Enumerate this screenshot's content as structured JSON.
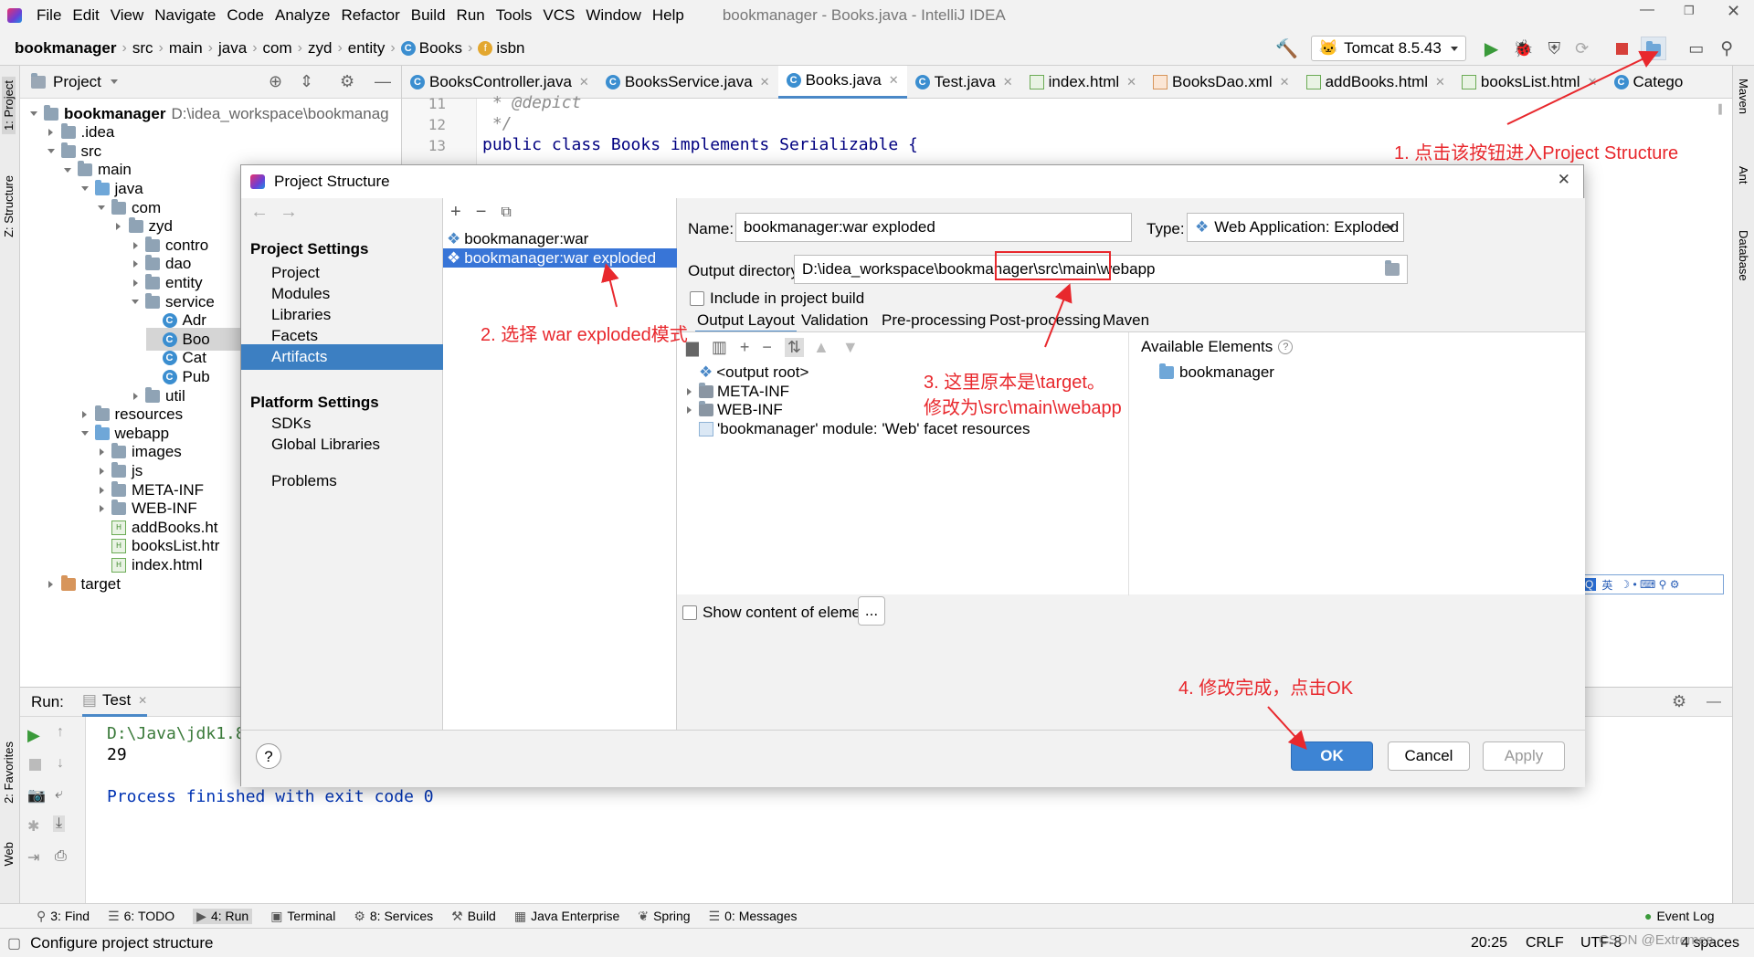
{
  "window": {
    "title": "bookmanager - Books.java - IntelliJ IDEA"
  },
  "menu": [
    "File",
    "Edit",
    "View",
    "Navigate",
    "Code",
    "Analyze",
    "Refactor",
    "Build",
    "Run",
    "Tools",
    "VCS",
    "Window",
    "Help"
  ],
  "breadcrumb": [
    "bookmanager",
    "src",
    "main",
    "java",
    "com",
    "zyd",
    "entity",
    "Books",
    "isbn"
  ],
  "run_config": "Tomcat 8.5.43",
  "project_panel": {
    "title": "Project",
    "tree": [
      {
        "label": "bookmanager",
        "extra": "D:\\idea_workspace\\bookmanag"
      },
      {
        "label": ".idea"
      },
      {
        "label": "src"
      },
      {
        "label": "main"
      },
      {
        "label": "java"
      },
      {
        "label": "com"
      },
      {
        "label": "zyd"
      },
      {
        "label": "contro"
      },
      {
        "label": "dao"
      },
      {
        "label": "entity"
      },
      {
        "label": "service"
      },
      {
        "label": "Adr"
      },
      {
        "label": "Boo"
      },
      {
        "label": "Cat"
      },
      {
        "label": "Pub"
      },
      {
        "label": "util"
      },
      {
        "label": "resources"
      },
      {
        "label": "webapp"
      },
      {
        "label": "images"
      },
      {
        "label": "js"
      },
      {
        "label": "META-INF"
      },
      {
        "label": "WEB-INF"
      },
      {
        "label": "addBooks.ht"
      },
      {
        "label": "booksList.htr"
      },
      {
        "label": "index.html"
      },
      {
        "label": "target"
      }
    ]
  },
  "editor": {
    "tabs": [
      "BooksController.java",
      "BooksService.java",
      "Books.java",
      "Test.java",
      "index.html",
      "BooksDao.xml",
      "addBooks.html",
      "booksList.html",
      "Catego"
    ],
    "active_tab": "Books.java",
    "lines": [
      {
        "num": "11",
        "text": " * @depict"
      },
      {
        "num": "12",
        "text": " */"
      },
      {
        "num": "13",
        "text": "public class Books implements Serializable {"
      }
    ]
  },
  "run_panel": {
    "label": "Run:",
    "tab": "Test",
    "output": [
      "D:\\Java\\jdk1.8",
      "29",
      "",
      "Process finished with exit code 0"
    ]
  },
  "left_stripe": [
    "1: Project",
    "Z: Structure",
    "2: Favorites",
    "Web"
  ],
  "right_stripe": [
    "Maven",
    "Ant",
    "Database"
  ],
  "tool_windows": [
    {
      "icon": "search-icon",
      "label": "3: Find"
    },
    {
      "icon": "todo-icon",
      "label": "6: TODO"
    },
    {
      "icon": "run-icon",
      "label": "4: Run"
    },
    {
      "icon": "terminal-icon",
      "label": "Terminal"
    },
    {
      "icon": "services-icon",
      "label": "8: Services"
    },
    {
      "icon": "build-icon",
      "label": "Build"
    },
    {
      "icon": "enterprise-icon",
      "label": "Java Enterprise"
    },
    {
      "icon": "spring-icon",
      "label": "Spring"
    },
    {
      "icon": "messages-icon",
      "label": "0: Messages"
    }
  ],
  "event_log": "Event Log",
  "status": {
    "message": "Configure project structure",
    "position": "20:25",
    "line_sep": "CRLF",
    "encoding": "UTF-8",
    "indent": "4 spaces",
    "watermark": "CSDN @Extremes",
    "ime": "英"
  },
  "dialog": {
    "title": "Project Structure",
    "project_settings_header": "Project Settings",
    "project_settings": [
      "Project",
      "Modules",
      "Libraries",
      "Facets",
      "Artifacts"
    ],
    "selected_setting": "Artifacts",
    "platform_settings_header": "Platform Settings",
    "platform_settings": [
      "SDKs",
      "Global Libraries"
    ],
    "problems": "Problems",
    "artifacts": [
      "bookmanager:war",
      "bookmanager:war exploded"
    ],
    "selected_artifact": "bookmanager:war exploded",
    "name_label": "Name:",
    "name_value": "bookmanager:war exploded",
    "type_label": "Type:",
    "type_value": "Web Application: Exploded",
    "output_label": "Output directory:",
    "output_value": "D:\\idea_workspace\\bookmanager\\src\\main\\webapp",
    "include_label": "Include in project build",
    "subtabs": [
      "Output Layout",
      "Validation",
      "Pre-processing",
      "Post-processing",
      "Maven"
    ],
    "active_subtab": "Output Layout",
    "layout_tree": [
      "<output root>",
      "META-INF",
      "WEB-INF",
      "'bookmanager' module: 'Web' facet resources"
    ],
    "available_label": "Available Elements",
    "available": [
      "bookmanager"
    ],
    "show_content_label": "Show content of elements",
    "ellipsis": "...",
    "ok": "OK",
    "cancel": "Cancel",
    "apply": "Apply",
    "help": "?"
  },
  "annotations": [
    "1. 点击该按钮进入Project Structure",
    "2. 选择 war exploded模式",
    "3. 这里原本是\\target。",
    "修改为\\src\\main\\webapp",
    "4. 修改完成，点击OK"
  ],
  "colors": {
    "accent": "#3875d7",
    "selection": "#3c7fc2",
    "annotation": "#e8282d",
    "ok_button": "#3d84d4"
  }
}
